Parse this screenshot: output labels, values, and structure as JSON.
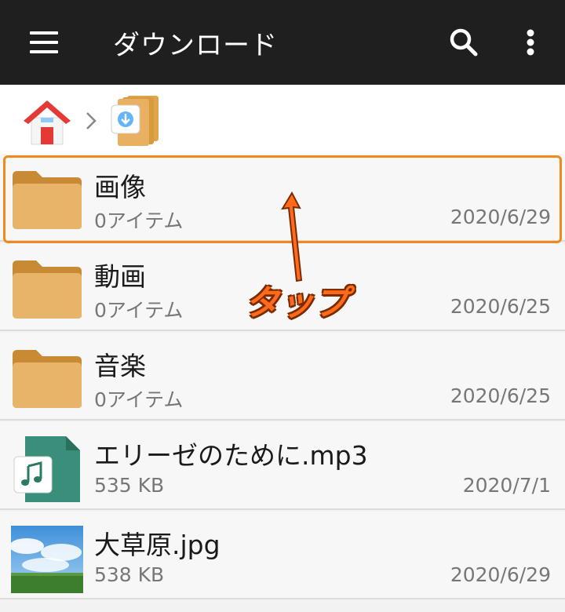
{
  "header": {
    "title": "ダウンロード",
    "menu_icon": "hamburger-menu-icon",
    "search_icon": "search-icon",
    "more_icon": "more-vert-icon",
    "background": "#1f1f1f"
  },
  "breadcrumb": {
    "items": [
      {
        "icon": "home-icon"
      },
      {
        "icon": "download-folder-icon"
      }
    ],
    "separator_icon": "chevron-right-icon"
  },
  "files": [
    {
      "name": "画像",
      "meta": "0アイテム",
      "date": "2020/6/29",
      "icon": "folder-icon"
    },
    {
      "name": "動画",
      "meta": "0アイテム",
      "date": "2020/6/25",
      "icon": "folder-icon"
    },
    {
      "name": "音楽",
      "meta": "0アイテム",
      "date": "2020/6/25",
      "icon": "folder-icon"
    },
    {
      "name": "エリーゼのために.mp3",
      "meta": "535 KB",
      "date": "2020/7/1",
      "icon": "music-file-icon"
    },
    {
      "name": "大草原.jpg",
      "meta": "538 KB",
      "date": "2020/6/29",
      "icon": "image-thumbnail"
    }
  ],
  "annotation": {
    "label": "タップ",
    "color": "#ff6a1c",
    "highlight_color": "#f08a1e"
  }
}
